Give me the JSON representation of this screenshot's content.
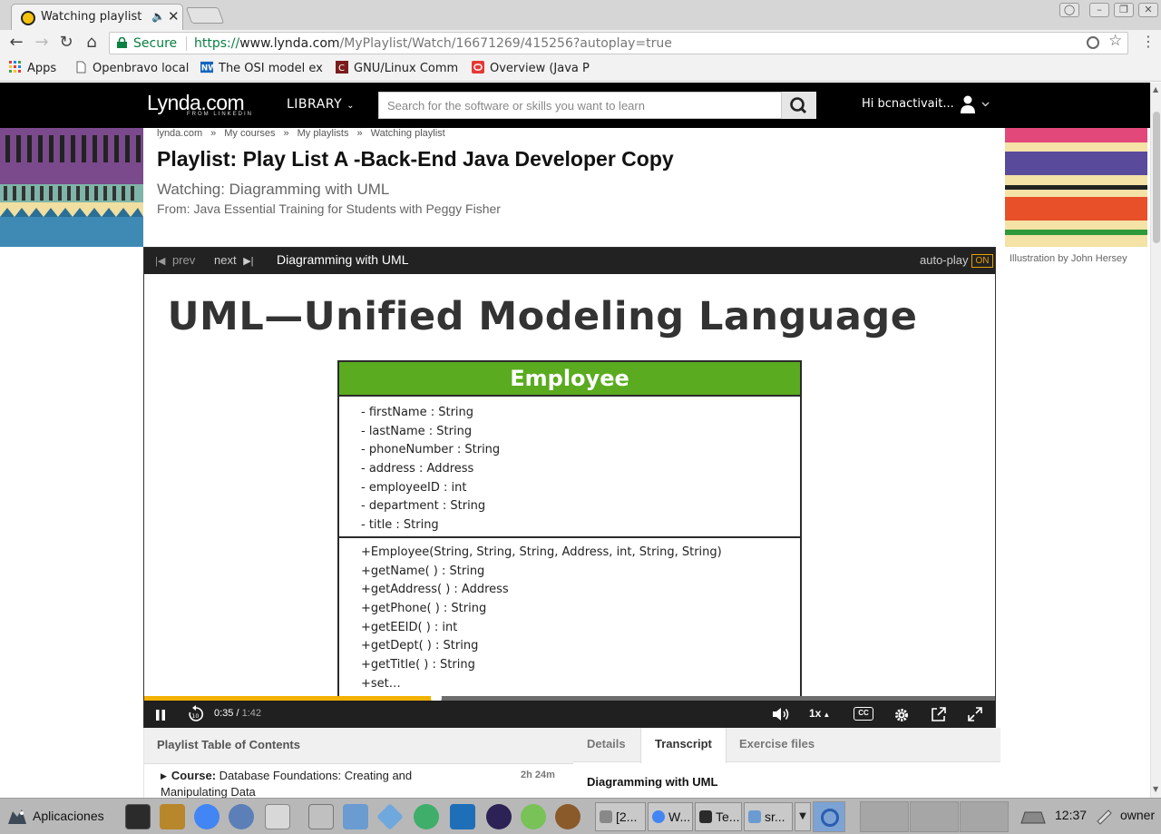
{
  "browser": {
    "tab_title": "Watching playlist",
    "url_scheme": "https://",
    "url_host": "www.lynda.com",
    "url_path": "/MyPlaylist/Watch/16671269/415256?autoplay=true",
    "secure_label": "Secure",
    "bookmarks": [
      {
        "label": "Apps",
        "icon": "apps-grid-icon"
      },
      {
        "label": "Openbravo local",
        "icon": "page-icon"
      },
      {
        "label": "The OSI model ex",
        "icon": "nw-icon"
      },
      {
        "label": "GNU/Linux Comm",
        "icon": "cutter-icon"
      },
      {
        "label": "Overview (Java P",
        "icon": "oracle-icon"
      }
    ]
  },
  "header": {
    "logo": "Lynda.com",
    "logo_sub": "FROM LINKEDIN",
    "library_label": "LIBRARY",
    "search_placeholder": "Search for the software or skills you want to learn",
    "greeting": "Hi bcnactivait..."
  },
  "breadcrumb": [
    "lynda.com",
    "My courses",
    "My playlists",
    "Watching playlist"
  ],
  "page": {
    "title": "Playlist: Play List A -Back-End Java Developer Copy",
    "watching": "Watching: Diagramming with UML",
    "from": "From: Java Essential Training for Students with Peggy Fisher",
    "illustration_credit": "Illustration by John Hersey"
  },
  "player": {
    "prev_label": "prev",
    "next_label": "next",
    "video_title": "Diagramming with UML",
    "autoplay_label": "auto-play",
    "autoplay_state": "ON",
    "current_time": "0:35",
    "duration": "1:42",
    "progress": 0.343,
    "speed": "1x",
    "cc_label": "CC"
  },
  "slide": {
    "heading": "UML—Unified Modeling Language",
    "class_name": "Employee",
    "attributes": [
      "- firstName : String",
      "- lastName : String",
      "- phoneNumber : String",
      "- address : Address",
      "- employeeID : int",
      "- department : String",
      "- title : String"
    ],
    "methods": [
      "+Employee(String, String, String, Address, int, String, String)",
      "+getName( ) : String",
      "+getAddress( ) : Address",
      "+getPhone( ) : String",
      "+getEEID( ) : int",
      "+getDept( ) : String",
      "+getTitle( ) : String",
      "+set…"
    ]
  },
  "toc": {
    "title": "Playlist Table of Contents",
    "item_prefix": "Course:",
    "item_name": " Database Foundations: Creating and Manipulating Data",
    "item_duration": "2h 24m"
  },
  "details_tabs": {
    "tabs": [
      "Details",
      "Transcript",
      "Exercise files"
    ],
    "active": "Transcript",
    "transcript_heading": "Diagramming with UML"
  },
  "taskbar": {
    "start_label": "Aplicaciones",
    "tasks": [
      "[2...",
      "W...",
      "Te...",
      "sr..."
    ],
    "clock": "12:37",
    "user": "owner"
  },
  "colors": {
    "accent_yellow": "#f2b100",
    "uml_green": "#5aab1f",
    "secure_green": "#0b8043"
  }
}
